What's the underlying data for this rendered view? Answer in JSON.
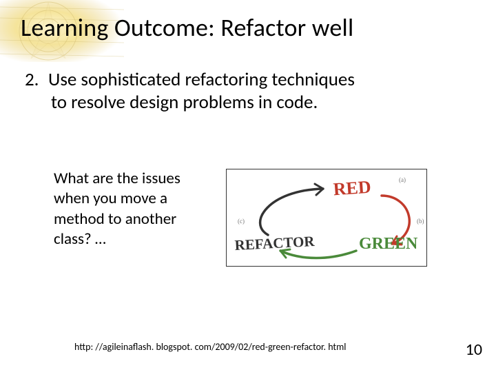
{
  "title": "Learning Outcome: Refactor well",
  "list": {
    "number": "2.",
    "text_line1": "Use sophisticated refactoring techniques",
    "text_line2": "to resolve design problems in code."
  },
  "subtext": "What are the issues when you move a method to another class? …",
  "diagram": {
    "label_red": "RED",
    "label_green": "GREEN",
    "label_refactor": "REFACTOR",
    "color_red": "#c23a2b",
    "color_green": "#4a8a3a",
    "color_refactor": "#333333"
  },
  "url": "http: //agileinaflash. blogspot. com/2009/02/red-green-refactor. html",
  "page_number": "10"
}
